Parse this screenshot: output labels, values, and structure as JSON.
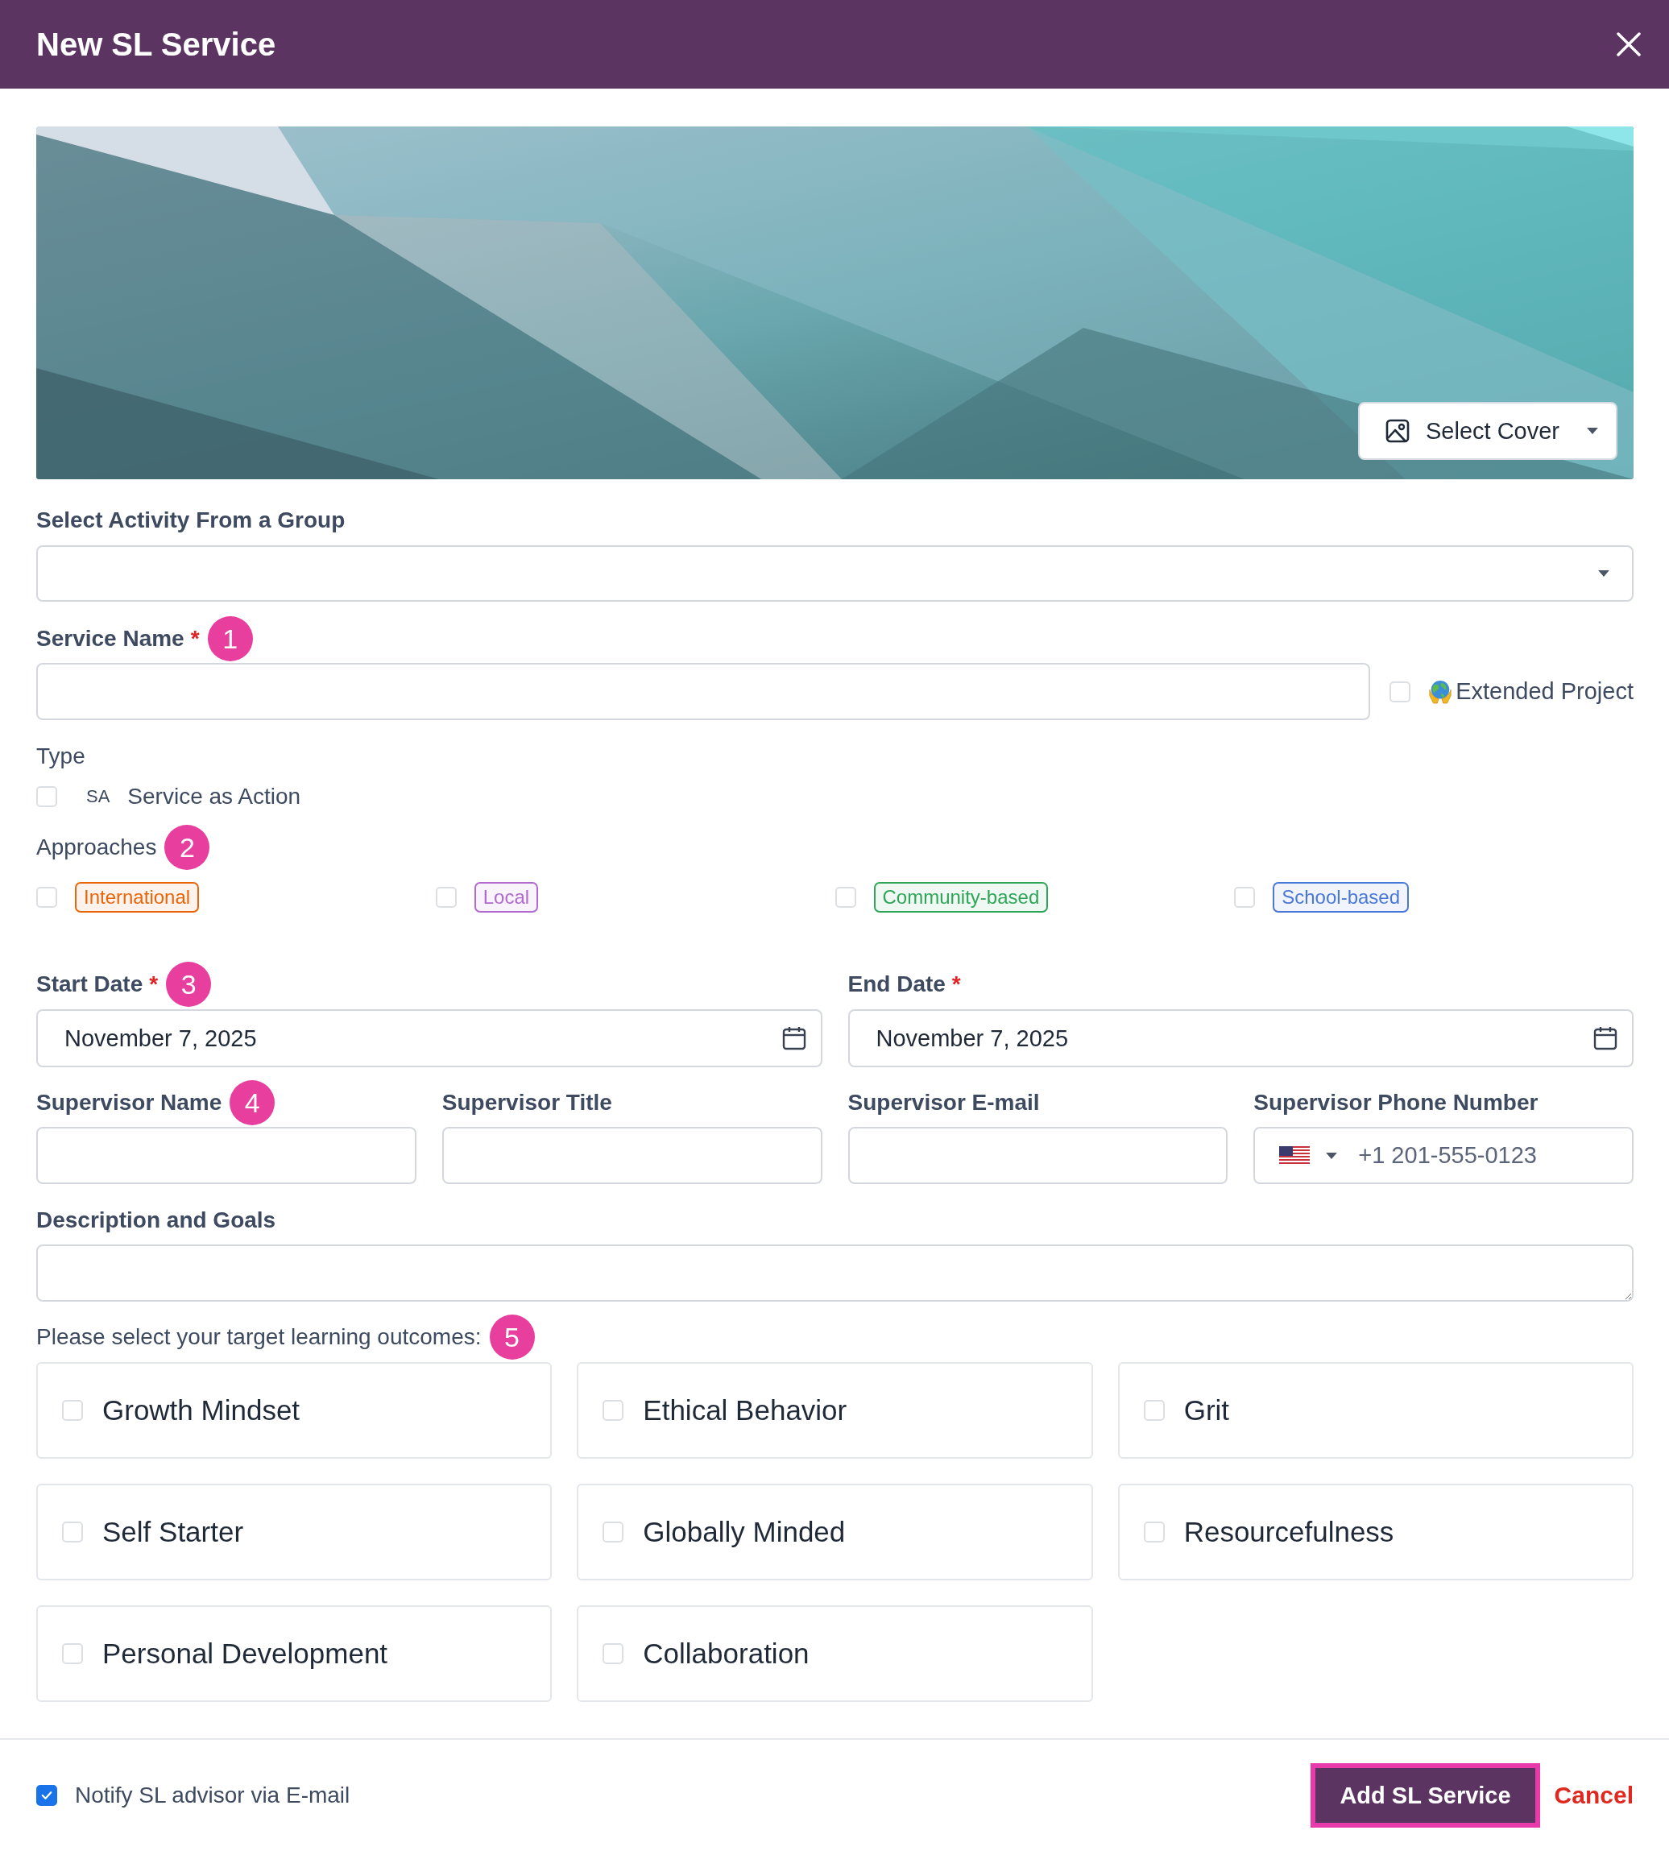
{
  "window": {
    "title": "New SL Service"
  },
  "required_mark": "*",
  "cover": {
    "kind": "picture",
    "button_label": "Select Cover"
  },
  "activity_group": {
    "label": "Select Activity From a Group"
  },
  "service_name": {
    "label": "Service Name",
    "required": true,
    "marker": "1"
  },
  "extended_project": {
    "label": "Extended Project",
    "checked": false
  },
  "type": {
    "label": "Type",
    "options": [
      {
        "code": "SA",
        "label": "Service as Action",
        "checked": false
      }
    ]
  },
  "approaches": {
    "label": "Approaches",
    "marker": "2",
    "options": [
      {
        "label": "International",
        "color": "#e8650c",
        "checked": false
      },
      {
        "label": "Local",
        "color": "#b06ad0",
        "checked": false
      },
      {
        "label": "Community-based",
        "color": "#2fa558",
        "checked": false
      },
      {
        "label": "School-based",
        "color": "#4a78d6",
        "checked": false
      }
    ]
  },
  "dates": [
    {
      "label": "Start Date",
      "required": true,
      "marker": "3",
      "value": "November 7, 2025"
    },
    {
      "label": "End Date",
      "required": true,
      "value": "November 7, 2025"
    }
  ],
  "supervisor": [
    {
      "label": "Supervisor Name",
      "marker": "4",
      "kind": "text"
    },
    {
      "label": "Supervisor Title",
      "kind": "text"
    },
    {
      "label": "Supervisor E-mail",
      "kind": "text"
    },
    {
      "label": "Supervisor Phone Number",
      "kind": "phone",
      "placeholder": "+1 201-555-0123"
    }
  ],
  "description": {
    "label": "Description and Goals"
  },
  "outcomes": {
    "prompt": "Please select your target learning outcomes:",
    "marker": "5",
    "items": [
      {
        "label": "Growth Mindset",
        "checked": false
      },
      {
        "label": "Ethical Behavior",
        "checked": false
      },
      {
        "label": "Grit",
        "checked": false
      },
      {
        "label": "Self Starter",
        "checked": false
      },
      {
        "label": "Globally Minded",
        "checked": false
      },
      {
        "label": "Resourcefulness",
        "checked": false
      },
      {
        "label": "Personal Development",
        "checked": false
      },
      {
        "label": "Collaboration",
        "checked": false
      }
    ]
  },
  "notify": {
    "label": "Notify SL advisor via E-mail",
    "checked": true
  },
  "buttons": [
    {
      "label": "Add SL Service",
      "kind": "primary"
    },
    {
      "label": "Cancel",
      "kind": "link"
    }
  ]
}
